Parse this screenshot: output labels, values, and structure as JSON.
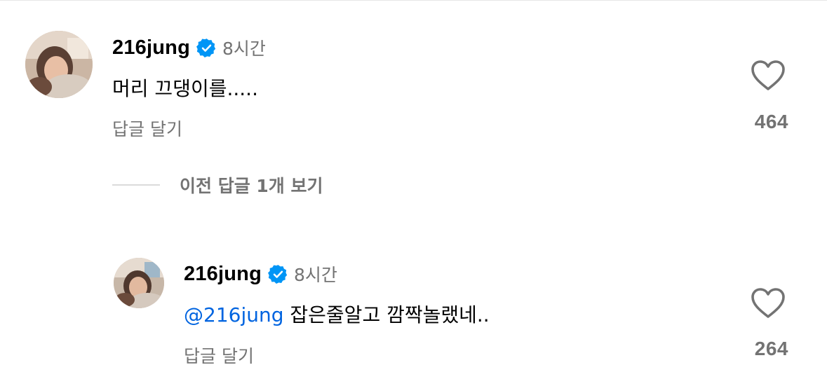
{
  "comments": [
    {
      "username": "216jung",
      "time": "8시간",
      "text": "머리 끄댕이를.....",
      "reply_label": "답글 달기",
      "likes": "464"
    }
  ],
  "view_previous_replies": "이전 답글 1개 보기",
  "replies": [
    {
      "username": "216jung",
      "time": "8시간",
      "mention": "@216jung",
      "text": " 잡은줄알고 깜짝놀랬네..",
      "reply_label": "답글 달기",
      "likes": "264"
    }
  ],
  "colors": {
    "verified_badge": "#0095f6",
    "mention": "#0064e0",
    "secondary_text": "#737373"
  },
  "icons": {
    "verified": "verified-badge-icon",
    "like": "heart-outline-icon"
  }
}
